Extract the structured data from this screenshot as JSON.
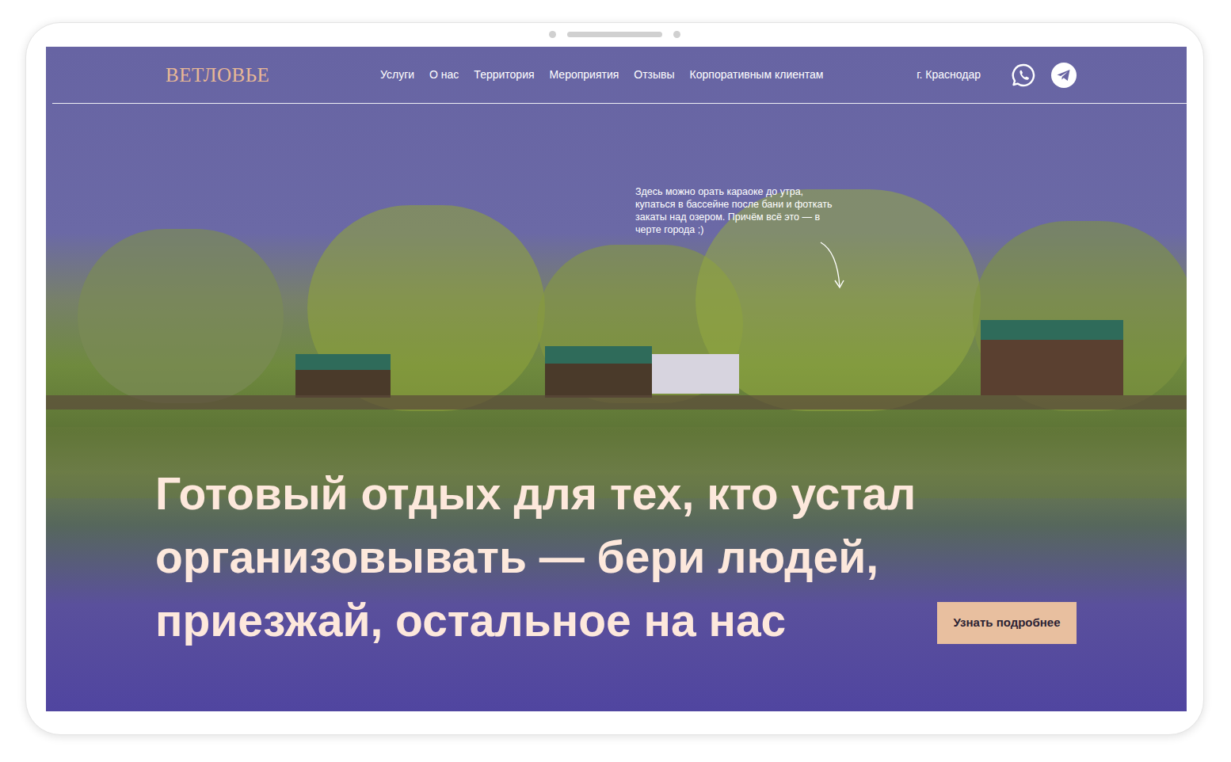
{
  "header": {
    "logo": "ВЕТЛОВЬЕ",
    "nav": [
      {
        "label": "Услуги"
      },
      {
        "label": "О нас"
      },
      {
        "label": "Территория"
      },
      {
        "label": "Мероприятия"
      },
      {
        "label": "Отзывы"
      },
      {
        "label": "Корпоративным клиентам"
      }
    ],
    "city": "г. Краснодар"
  },
  "hero": {
    "note": "Здесь можно орать караоке до утра, купаться в бассейне после бани и фоткать закаты над озером. Причём всё это — в черте города ;)",
    "headline": [
      "Готовый отдых для тех, кто устал",
      "организовывать — бери людей,",
      "приезжай, остальное на нас"
    ],
    "button": "Узнать подробнее"
  }
}
